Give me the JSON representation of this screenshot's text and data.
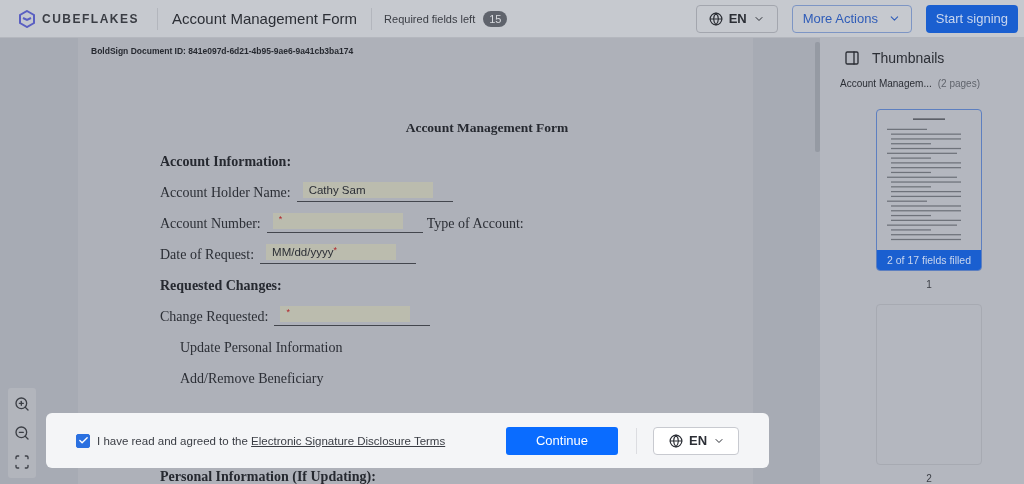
{
  "header": {
    "logo": "CUBEFLAKES",
    "title": "Account Management Form",
    "required_label": "Required fields left",
    "required_count": "15",
    "language": "EN",
    "more_actions": "More Actions",
    "start_signing": "Start signing"
  },
  "document": {
    "doc_id": "BoldSign Document ID: 841e097d-6d21-4b95-9ae6-9a41cb3ba174",
    "title": "Account Management Form",
    "lines": [
      {
        "kind": "heading",
        "text": "Account Information:"
      },
      {
        "kind": "field",
        "label": "Account Holder Name:",
        "value": "Cathy Sam"
      },
      {
        "kind": "field",
        "label": "Account Number:",
        "mark": "*",
        "after": "Type of Account:"
      },
      {
        "kind": "field",
        "label": "Date of Request:",
        "placeholder": "MM/dd/yyyy",
        "mark": "*"
      },
      {
        "kind": "heading",
        "text": "Requested Changes:"
      },
      {
        "kind": "field",
        "label": "Change Requested:",
        "mark": "*"
      },
      {
        "kind": "option",
        "text": "Update Personal Information"
      },
      {
        "kind": "option",
        "text": "Add/Remove Beneficiary"
      },
      {
        "kind": "spacer"
      },
      {
        "kind": "heading",
        "text": "Personal Information (If Updating):"
      }
    ]
  },
  "thumbnails": {
    "title": "Thumbnails",
    "doc_name": "Account Managem...",
    "pages_count": "(2 pages)",
    "pages": [
      {
        "number": "1",
        "selected": true,
        "status": "2 of 17 fields filled"
      },
      {
        "number": "2",
        "selected": false
      }
    ]
  },
  "consent": {
    "checked": true,
    "text": "I have read and agreed to the",
    "link": "Electronic Signature Disclosure Terms",
    "continue": "Continue",
    "language": "EN"
  }
}
